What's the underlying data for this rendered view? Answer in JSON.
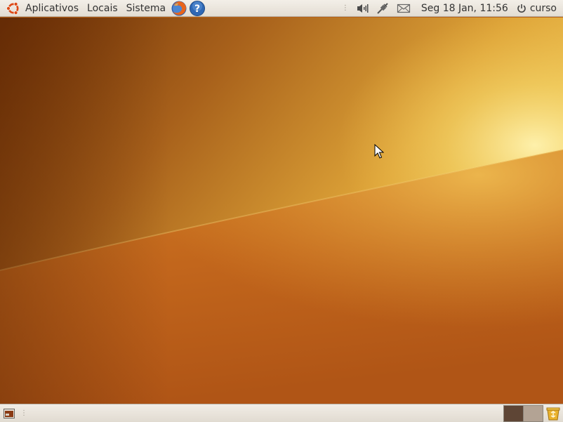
{
  "top_panel": {
    "menus": [
      "Aplicativos",
      "Locais",
      "Sistema"
    ],
    "clock": "Seg 18 Jan, 11:56",
    "user": "curso",
    "launchers": [
      "firefox-icon",
      "help-icon"
    ],
    "tray": [
      "volume-icon",
      "network-icon",
      "mail-icon"
    ]
  },
  "bottom_panel": {
    "workspaces": [
      "Workspace 1",
      "Workspace 2"
    ]
  },
  "colors": {
    "wallpaper_dark": "#7a3a08",
    "wallpaper_mid": "#c47a22",
    "wallpaper_light": "#f5d878",
    "panel": "#ece8e0"
  }
}
